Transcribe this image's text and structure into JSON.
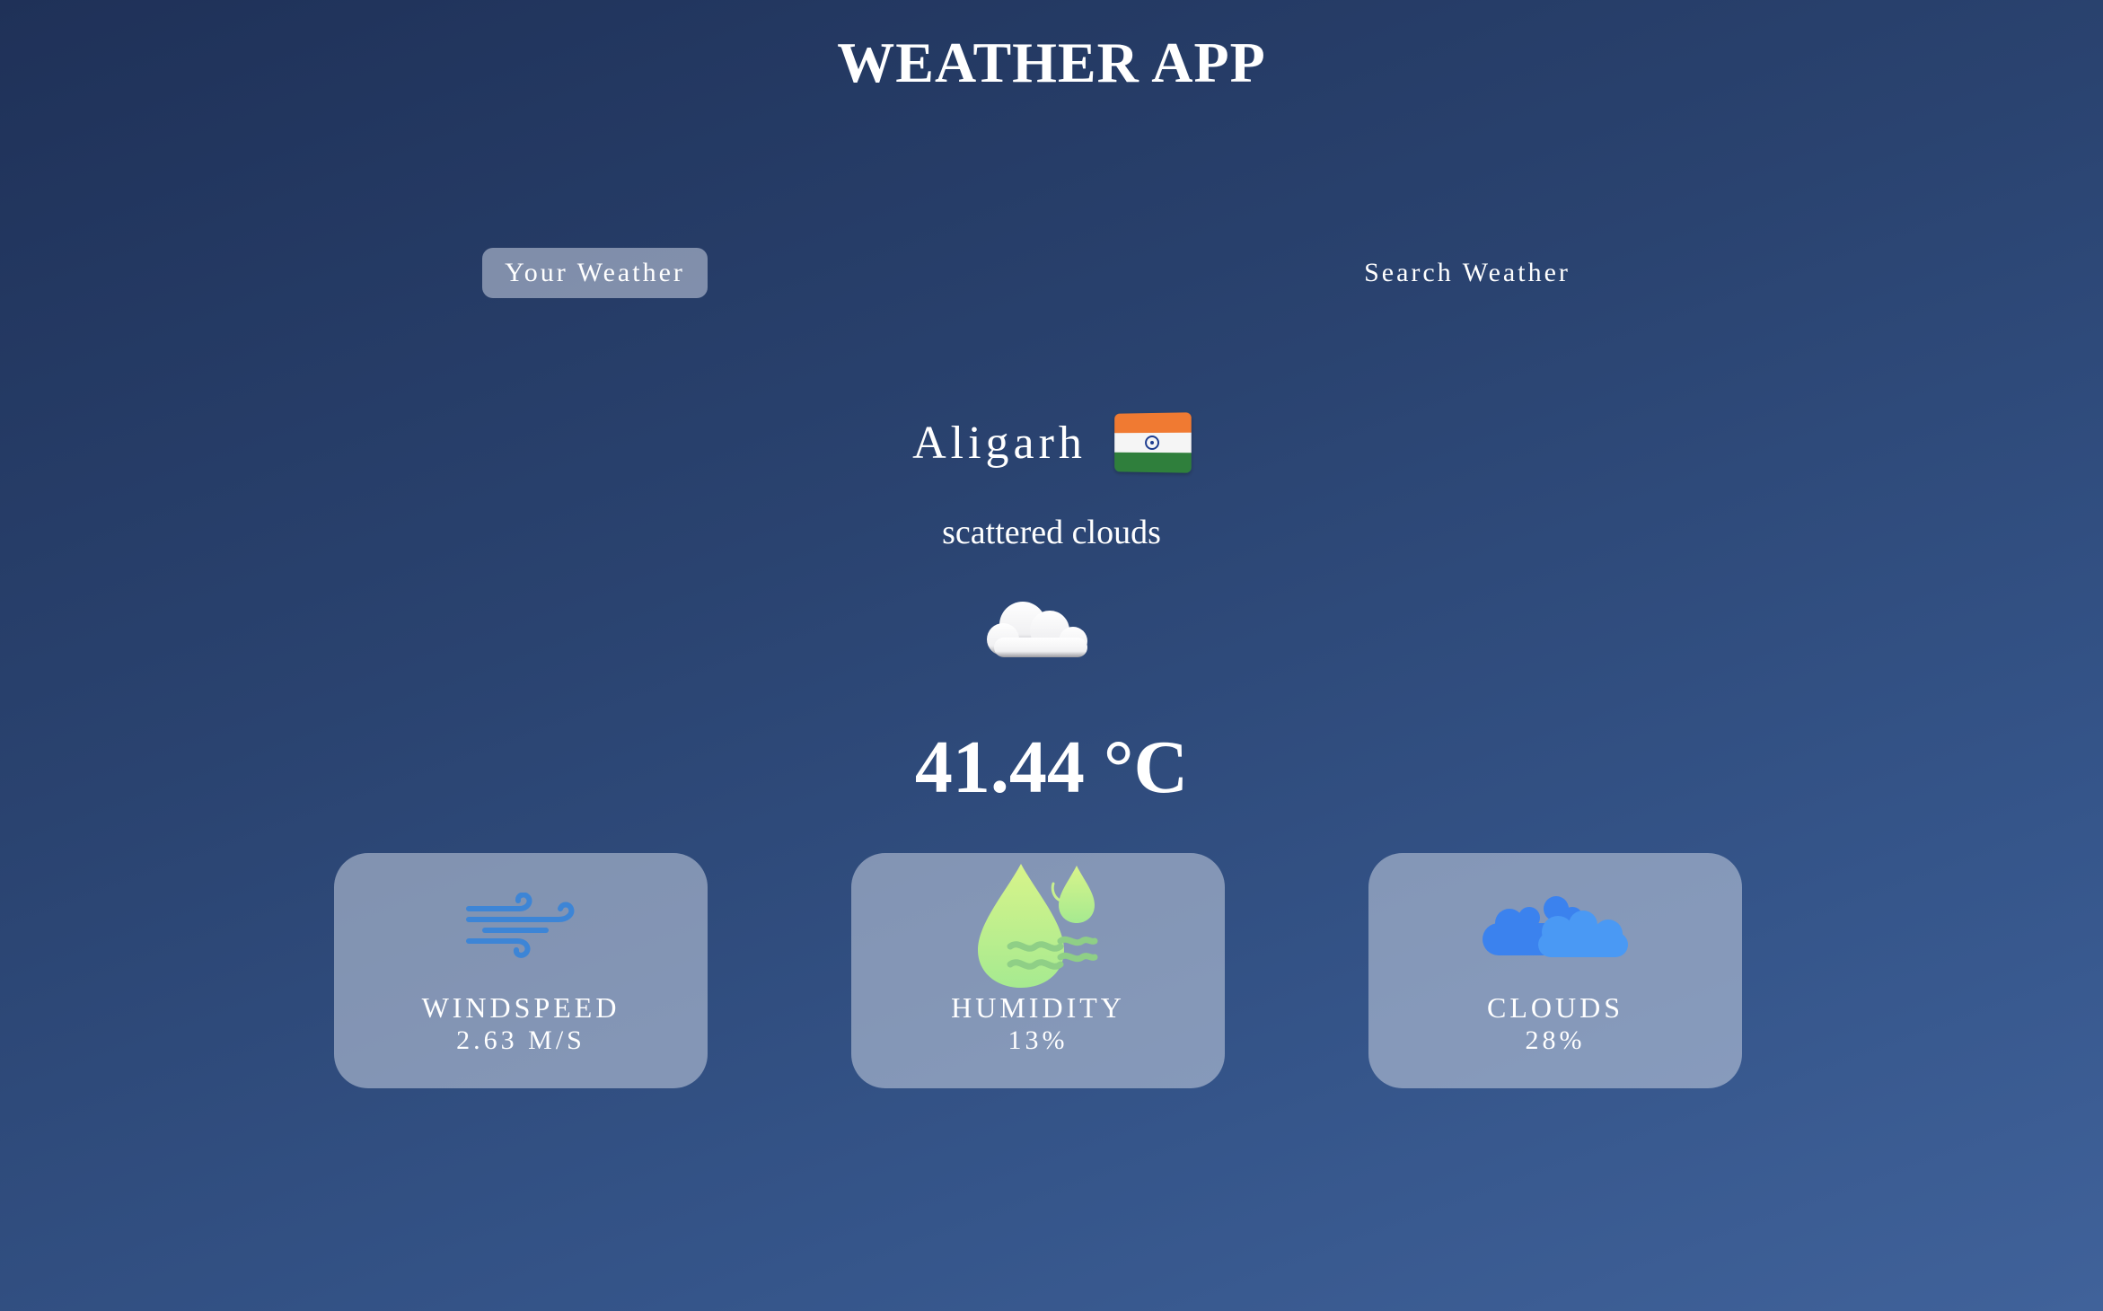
{
  "header": {
    "title": "WEATHER APP"
  },
  "tabs": [
    {
      "label": "Your Weather",
      "active": true
    },
    {
      "label": "Search Weather",
      "active": false
    }
  ],
  "location": {
    "city": "Aligarh",
    "flag_icon": "india-flag-icon"
  },
  "weather": {
    "description": "scattered clouds",
    "icon": "cloud-icon",
    "temperature": "41.44 °C"
  },
  "cards": [
    {
      "icon": "wind-icon",
      "label": "WINDSPEED",
      "value": "2.63 M/S"
    },
    {
      "icon": "humidity-icon",
      "label": "HUMIDITY",
      "value": "13%"
    },
    {
      "icon": "clouds-icon",
      "label": "CLOUDS",
      "value": "28%"
    }
  ],
  "colors": {
    "wind_icon": "#3d85d6",
    "humidity_icon": "#c8f08a",
    "clouds_icon": "#4a8ef0"
  }
}
